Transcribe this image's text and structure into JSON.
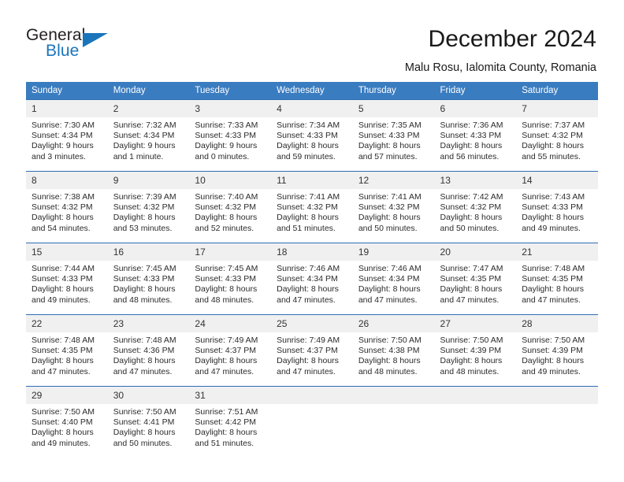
{
  "brand": {
    "name_top": "General",
    "name_bottom": "Blue",
    "accent_color": "#1b75bb"
  },
  "header": {
    "title": "December 2024",
    "subtitle": "Malu Rosu, Ialomita County, Romania"
  },
  "calendar": {
    "header_bg": "#3a7cc0",
    "daynum_bg": "#f0f0f0",
    "cell_border": "#2f6eb5",
    "weekday_labels": [
      "Sunday",
      "Monday",
      "Tuesday",
      "Wednesday",
      "Thursday",
      "Friday",
      "Saturday"
    ],
    "labels": {
      "sunrise": "Sunrise:",
      "sunset": "Sunset:",
      "daylight": "Daylight:"
    },
    "weeks": [
      [
        {
          "day": "1",
          "sunrise": "Sunrise: 7:30 AM",
          "sunset": "Sunset: 4:34 PM",
          "daylight_1": "Daylight: 9 hours",
          "daylight_2": "and 3 minutes."
        },
        {
          "day": "2",
          "sunrise": "Sunrise: 7:32 AM",
          "sunset": "Sunset: 4:34 PM",
          "daylight_1": "Daylight: 9 hours",
          "daylight_2": "and 1 minute."
        },
        {
          "day": "3",
          "sunrise": "Sunrise: 7:33 AM",
          "sunset": "Sunset: 4:33 PM",
          "daylight_1": "Daylight: 9 hours",
          "daylight_2": "and 0 minutes."
        },
        {
          "day": "4",
          "sunrise": "Sunrise: 7:34 AM",
          "sunset": "Sunset: 4:33 PM",
          "daylight_1": "Daylight: 8 hours",
          "daylight_2": "and 59 minutes."
        },
        {
          "day": "5",
          "sunrise": "Sunrise: 7:35 AM",
          "sunset": "Sunset: 4:33 PM",
          "daylight_1": "Daylight: 8 hours",
          "daylight_2": "and 57 minutes."
        },
        {
          "day": "6",
          "sunrise": "Sunrise: 7:36 AM",
          "sunset": "Sunset: 4:33 PM",
          "daylight_1": "Daylight: 8 hours",
          "daylight_2": "and 56 minutes."
        },
        {
          "day": "7",
          "sunrise": "Sunrise: 7:37 AM",
          "sunset": "Sunset: 4:32 PM",
          "daylight_1": "Daylight: 8 hours",
          "daylight_2": "and 55 minutes."
        }
      ],
      [
        {
          "day": "8",
          "sunrise": "Sunrise: 7:38 AM",
          "sunset": "Sunset: 4:32 PM",
          "daylight_1": "Daylight: 8 hours",
          "daylight_2": "and 54 minutes."
        },
        {
          "day": "9",
          "sunrise": "Sunrise: 7:39 AM",
          "sunset": "Sunset: 4:32 PM",
          "daylight_1": "Daylight: 8 hours",
          "daylight_2": "and 53 minutes."
        },
        {
          "day": "10",
          "sunrise": "Sunrise: 7:40 AM",
          "sunset": "Sunset: 4:32 PM",
          "daylight_1": "Daylight: 8 hours",
          "daylight_2": "and 52 minutes."
        },
        {
          "day": "11",
          "sunrise": "Sunrise: 7:41 AM",
          "sunset": "Sunset: 4:32 PM",
          "daylight_1": "Daylight: 8 hours",
          "daylight_2": "and 51 minutes."
        },
        {
          "day": "12",
          "sunrise": "Sunrise: 7:41 AM",
          "sunset": "Sunset: 4:32 PM",
          "daylight_1": "Daylight: 8 hours",
          "daylight_2": "and 50 minutes."
        },
        {
          "day": "13",
          "sunrise": "Sunrise: 7:42 AM",
          "sunset": "Sunset: 4:32 PM",
          "daylight_1": "Daylight: 8 hours",
          "daylight_2": "and 50 minutes."
        },
        {
          "day": "14",
          "sunrise": "Sunrise: 7:43 AM",
          "sunset": "Sunset: 4:33 PM",
          "daylight_1": "Daylight: 8 hours",
          "daylight_2": "and 49 minutes."
        }
      ],
      [
        {
          "day": "15",
          "sunrise": "Sunrise: 7:44 AM",
          "sunset": "Sunset: 4:33 PM",
          "daylight_1": "Daylight: 8 hours",
          "daylight_2": "and 49 minutes."
        },
        {
          "day": "16",
          "sunrise": "Sunrise: 7:45 AM",
          "sunset": "Sunset: 4:33 PM",
          "daylight_1": "Daylight: 8 hours",
          "daylight_2": "and 48 minutes."
        },
        {
          "day": "17",
          "sunrise": "Sunrise: 7:45 AM",
          "sunset": "Sunset: 4:33 PM",
          "daylight_1": "Daylight: 8 hours",
          "daylight_2": "and 48 minutes."
        },
        {
          "day": "18",
          "sunrise": "Sunrise: 7:46 AM",
          "sunset": "Sunset: 4:34 PM",
          "daylight_1": "Daylight: 8 hours",
          "daylight_2": "and 47 minutes."
        },
        {
          "day": "19",
          "sunrise": "Sunrise: 7:46 AM",
          "sunset": "Sunset: 4:34 PM",
          "daylight_1": "Daylight: 8 hours",
          "daylight_2": "and 47 minutes."
        },
        {
          "day": "20",
          "sunrise": "Sunrise: 7:47 AM",
          "sunset": "Sunset: 4:35 PM",
          "daylight_1": "Daylight: 8 hours",
          "daylight_2": "and 47 minutes."
        },
        {
          "day": "21",
          "sunrise": "Sunrise: 7:48 AM",
          "sunset": "Sunset: 4:35 PM",
          "daylight_1": "Daylight: 8 hours",
          "daylight_2": "and 47 minutes."
        }
      ],
      [
        {
          "day": "22",
          "sunrise": "Sunrise: 7:48 AM",
          "sunset": "Sunset: 4:35 PM",
          "daylight_1": "Daylight: 8 hours",
          "daylight_2": "and 47 minutes."
        },
        {
          "day": "23",
          "sunrise": "Sunrise: 7:48 AM",
          "sunset": "Sunset: 4:36 PM",
          "daylight_1": "Daylight: 8 hours",
          "daylight_2": "and 47 minutes."
        },
        {
          "day": "24",
          "sunrise": "Sunrise: 7:49 AM",
          "sunset": "Sunset: 4:37 PM",
          "daylight_1": "Daylight: 8 hours",
          "daylight_2": "and 47 minutes."
        },
        {
          "day": "25",
          "sunrise": "Sunrise: 7:49 AM",
          "sunset": "Sunset: 4:37 PM",
          "daylight_1": "Daylight: 8 hours",
          "daylight_2": "and 47 minutes."
        },
        {
          "day": "26",
          "sunrise": "Sunrise: 7:50 AM",
          "sunset": "Sunset: 4:38 PM",
          "daylight_1": "Daylight: 8 hours",
          "daylight_2": "and 48 minutes."
        },
        {
          "day": "27",
          "sunrise": "Sunrise: 7:50 AM",
          "sunset": "Sunset: 4:39 PM",
          "daylight_1": "Daylight: 8 hours",
          "daylight_2": "and 48 minutes."
        },
        {
          "day": "28",
          "sunrise": "Sunrise: 7:50 AM",
          "sunset": "Sunset: 4:39 PM",
          "daylight_1": "Daylight: 8 hours",
          "daylight_2": "and 49 minutes."
        }
      ],
      [
        {
          "day": "29",
          "sunrise": "Sunrise: 7:50 AM",
          "sunset": "Sunset: 4:40 PM",
          "daylight_1": "Daylight: 8 hours",
          "daylight_2": "and 49 minutes."
        },
        {
          "day": "30",
          "sunrise": "Sunrise: 7:50 AM",
          "sunset": "Sunset: 4:41 PM",
          "daylight_1": "Daylight: 8 hours",
          "daylight_2": "and 50 minutes."
        },
        {
          "day": "31",
          "sunrise": "Sunrise: 7:51 AM",
          "sunset": "Sunset: 4:42 PM",
          "daylight_1": "Daylight: 8 hours",
          "daylight_2": "and 51 minutes."
        },
        {
          "day": "",
          "sunrise": "",
          "sunset": "",
          "daylight_1": "",
          "daylight_2": ""
        },
        {
          "day": "",
          "sunrise": "",
          "sunset": "",
          "daylight_1": "",
          "daylight_2": ""
        },
        {
          "day": "",
          "sunrise": "",
          "sunset": "",
          "daylight_1": "",
          "daylight_2": ""
        },
        {
          "day": "",
          "sunrise": "",
          "sunset": "",
          "daylight_1": "",
          "daylight_2": ""
        }
      ]
    ]
  }
}
